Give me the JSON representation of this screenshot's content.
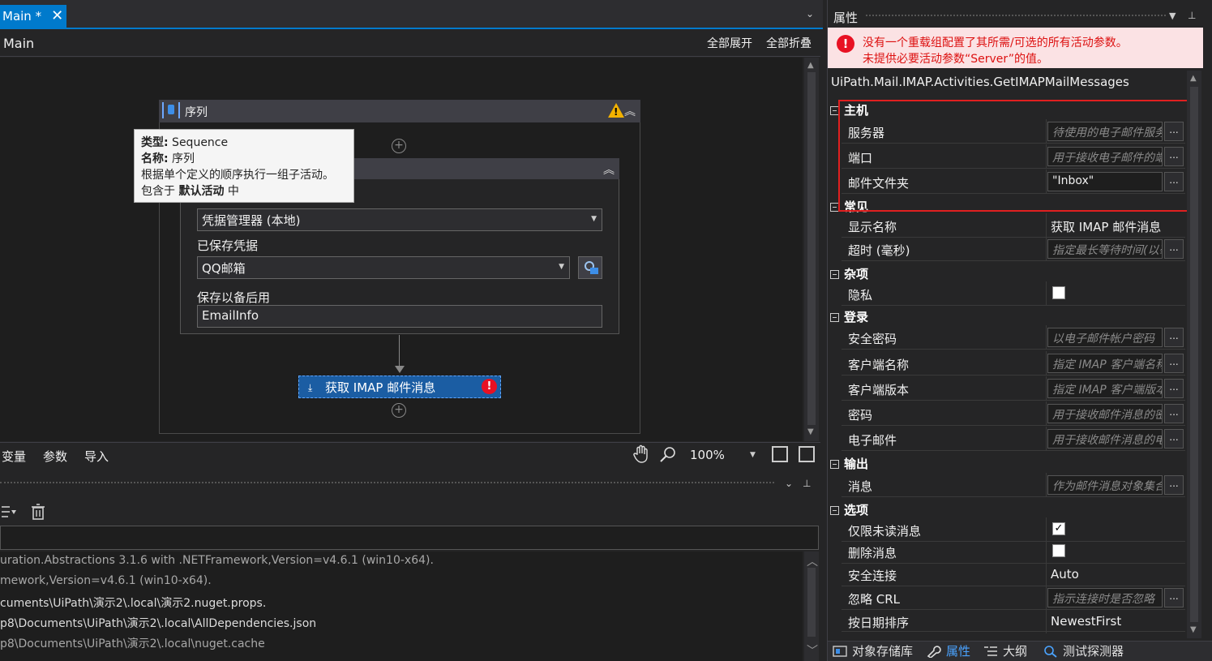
{
  "tabs": {
    "main_label": "Main *",
    "close": "✕",
    "dropdown": "⌄"
  },
  "designer": {
    "breadcrumb": "Main",
    "expand_all": "全部展开",
    "collapse_all": "全部折叠",
    "sequence_title": "序列",
    "tooltip": {
      "type_label": "类型:",
      "type_value": " Sequence",
      "name_label": "名称:",
      "name_value": " 序列",
      "description": "根据单个定义的顺序执行一组子活动。",
      "contained_prefix": "包含于 ",
      "contained_value": "默认活动",
      "contained_suffix": " 中"
    },
    "credential_source": "凭据管理器 (本地)",
    "saved_credential_label": "已保存凭据",
    "saved_credential_value": "QQ邮箱",
    "save_for_later_label": "保存以备后用",
    "save_for_later_value": "EmailInfo",
    "imap_activity": "获取 IMAP 邮件消息",
    "bottom_tabs": [
      "变量",
      "参数",
      "导入"
    ],
    "zoom": "100%"
  },
  "output": {
    "lines": [
      "uration.Abstractions 3.1.6 with .NETFramework,Version=v4.6.1 (win10-x64).",
      "mework,Version=v4.6.1 (win10-x64).",
      "cuments\\UiPath\\演示2\\.local\\演示2.nuget.props.",
      "p8\\Documents\\UiPath\\演示2\\.local\\AllDependencies.json",
      "p8\\Documents\\UiPath\\演示2\\.local\\nuget.cache"
    ]
  },
  "properties": {
    "title": "属性",
    "error_line1": "没有一个重载组配置了其所需/可选的所有活动参数。",
    "error_line2": "未提供必要活动参数“Server”的值。",
    "activity_type": "UiPath.Mail.IMAP.Activities.GetIMAPMailMessages",
    "categories": {
      "host": "主机",
      "common": "常见",
      "misc": "杂项",
      "login": "登录",
      "output": "输出",
      "options": "选项"
    },
    "rows": {
      "server": {
        "name": "服务器",
        "placeholder": "待使用的电子邮件服务器主机"
      },
      "port": {
        "name": "端口",
        "placeholder": "用于接收电子邮件的端口"
      },
      "mail_folder": {
        "name": "邮件文件夹",
        "value": "\"Inbox\""
      },
      "display_name": {
        "name": "显示名称",
        "value": "获取 IMAP 邮件消息"
      },
      "timeout": {
        "name": "超时 (毫秒)",
        "placeholder": "指定最长等待时间(以毫秒为单位)"
      },
      "private": {
        "name": "隐私",
        "checked": false
      },
      "secure_password": {
        "name": "安全密码",
        "placeholder": "以电子邮件帐户密码"
      },
      "client_name": {
        "name": "客户端名称",
        "placeholder": "指定 IMAP 客户端名称"
      },
      "client_version": {
        "name": "客户端版本",
        "placeholder": "指定 IMAP 客户端版本"
      },
      "password": {
        "name": "密码",
        "placeholder": "用于接收邮件消息的密码"
      },
      "email": {
        "name": "电子邮件",
        "placeholder": "用于接收邮件消息的电子邮件"
      },
      "messages": {
        "name": "消息",
        "placeholder": "作为邮件消息对象集合"
      },
      "only_unread": {
        "name": "仅限未读消息",
        "checked": true
      },
      "delete_messages": {
        "name": "删除消息",
        "checked": false
      },
      "secure_connection": {
        "name": "安全连接",
        "value": "Auto"
      },
      "ignore_crl": {
        "name": "忽略 CRL",
        "placeholder": "指示连接时是否忽略"
      },
      "order_by_date": {
        "name": "按日期排序",
        "value": "NewestFirst"
      }
    },
    "ellipsis": "...",
    "bottom_tabs": [
      "对象存储库",
      "属性",
      "大纲",
      "测试探测器"
    ]
  },
  "colors": {
    "accent": "#007acc",
    "error": "#e81123",
    "warning": "#f2b100",
    "highlight_frame": "#e02020"
  }
}
